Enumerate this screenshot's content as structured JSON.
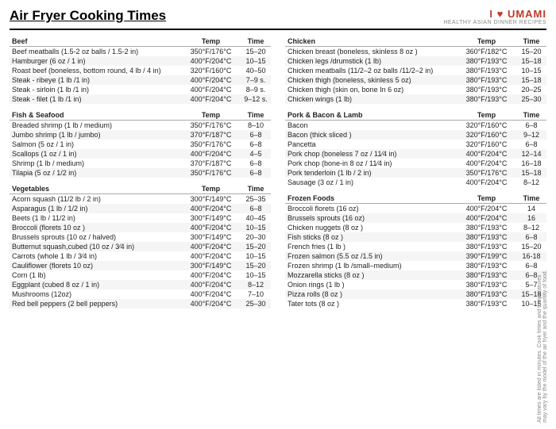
{
  "header": {
    "title": "Air Fryer Cooking Times",
    "brand_name": "I HEART UMAMI",
    "brand_heart": "♥",
    "brand_tagline": "HEALTHY ASIAN DINNER RECIPES",
    "footer_note": "All times are listed in minutes. Cook times and temperatures may vary by the model of the air fryer and the quantity of food."
  },
  "sections": [
    {
      "id": "beef",
      "title": "Beef",
      "col_temp": "Temp",
      "col_time": "Time",
      "rows": [
        [
          "Beef meatballs (1.5-2 oz balls / 1.5-2 in)",
          "350°F/176°C",
          "15–20"
        ],
        [
          "Hamburger (6 oz / 1 in)",
          "400°F/204°C",
          "10–15"
        ],
        [
          "Roast beef (boneless, bottom round, 4 lb / 4 in)",
          "320°F/160°C",
          "40–50"
        ],
        [
          "Steak - ribeye (1 lb /1 in)",
          "400°F/204°C",
          "7–9 s."
        ],
        [
          "Steak - sirloin (1 lb /1 in)",
          "400°F/204°C",
          "8–9 s."
        ],
        [
          "Steak - filet (1 lb /1 in)",
          "400°F/204°C",
          "9–12 s."
        ]
      ]
    },
    {
      "id": "chicken",
      "title": "Chicken",
      "col_temp": "Temp",
      "col_time": "Time",
      "rows": [
        [
          "Chicken breast (boneless, skinless 8 oz )",
          "360°F/182°C",
          "15–20"
        ],
        [
          "Chicken legs /drumstick (1 lb)",
          "380°F/193°C",
          "15–18"
        ],
        [
          "Chicken meatballs (11/2–2 oz balls /11/2–2 in)",
          "380°F/193°C",
          "10–15"
        ],
        [
          "Chicken thigh (boneless, skinless 5 oz)",
          "380°F/193°C",
          "15–18"
        ],
        [
          "Chicken thigh (skin on, bone In 6 oz)",
          "380°F/193°C",
          "20–25"
        ],
        [
          "Chicken wings (1 lb)",
          "380°F/193°C",
          "25–30"
        ]
      ]
    },
    {
      "id": "fish",
      "title": "Fish & Seafood",
      "col_temp": "Temp",
      "col_time": "Time",
      "rows": [
        [
          "Breaded shrimp (1 lb / medium)",
          "350°F/176°C",
          "8–10"
        ],
        [
          "Jumbo shrimp (1 lb / jumbo)",
          "370°F/187°C",
          "6–8"
        ],
        [
          "Salmon (5 oz / 1 in)",
          "350°F/176°C",
          "6–8"
        ],
        [
          "Scallops (1 oz / 1 in)",
          "400°F/204°C",
          "4–5"
        ],
        [
          "Shrimp (1 lb / medium)",
          "370°F/187°C",
          "6–8"
        ],
        [
          "Tilapia (5 oz / 1/2 in)",
          "350°F/176°C",
          "6–8"
        ]
      ]
    },
    {
      "id": "pork",
      "title": "Pork & Bacon & Lamb",
      "col_temp": "Temp",
      "col_time": "Time",
      "rows": [
        [
          "Bacon",
          "320°F/160°C",
          "6–8"
        ],
        [
          "Bacon (thick sliced )",
          "320°F/160°C",
          "9–12"
        ],
        [
          "Pancetta",
          "320°F/160°C",
          "6–8"
        ],
        [
          "Pork chop (boneless 7 oz / 11⁄4 in)",
          "400°F/204°C",
          "12–14"
        ],
        [
          "Pork chop (bone-in 8 oz / 11⁄4 in)",
          "400°F/204°C",
          "16–18"
        ],
        [
          "Pork tenderloin (1 lb / 2 in)",
          "350°F/176°C",
          "15–18"
        ],
        [
          "Sausage (3 oz / 1 in)",
          "400°F/204°C",
          "8–12"
        ]
      ]
    },
    {
      "id": "vegetables",
      "title": "Vegetables",
      "col_temp": "Temp",
      "col_time": "Time",
      "rows": [
        [
          "Acorn squash (11/2 lb / 2 in)",
          "300°F/149°C",
          "25–35"
        ],
        [
          "Asparagus (1 lb / 1/2 in)",
          "400°F/204°C",
          "6–8"
        ],
        [
          "Beets (1 lb / 11/2 in)",
          "300°F/149°C",
          "40–45"
        ],
        [
          "Broccoli (florets 10 oz )",
          "400°F/204°C",
          "10–15"
        ],
        [
          "Brussels sprouts (10 oz / halved)",
          "300°F/149°C",
          "20–30"
        ],
        [
          "Butternut squash,cubed (10 oz / 3⁄4 in)",
          "400°F/204°C",
          "15–20"
        ],
        [
          "Carrots (whole 1 lb / 3⁄4 in)",
          "400°F/204°C",
          "10–15"
        ],
        [
          "Cauliflower (florets 10 oz)",
          "300°F/149°C",
          "15–20"
        ],
        [
          "Corn (1 lb)",
          "400°F/204°C",
          "10–15"
        ],
        [
          "Eggplant (cubed 8 oz / 1 in)",
          "400°F/204°C",
          "8–12"
        ],
        [
          "Mushrooms (12oz)",
          "400°F/204°C",
          "7–10"
        ],
        [
          "Red bell peppers (2 bell peppers)",
          "400°F/204°C",
          "25–30"
        ]
      ]
    },
    {
      "id": "frozen",
      "title": "Frozen Foods",
      "col_temp": "Temp",
      "col_time": "Time",
      "rows": [
        [
          "Broccoli florets (16 oz)",
          "400°F/204°C",
          "14"
        ],
        [
          "Brussels sprouts (16 oz)",
          "400°F/204°C",
          "16"
        ],
        [
          "Chicken nuggets (8 oz )",
          "380°F/193°C",
          "8–12"
        ],
        [
          "Fish sticks (8 oz )",
          "380°F/193°C",
          "6–8"
        ],
        [
          "French fries (1 lb )",
          "380°F/193°C",
          "15–20"
        ],
        [
          "Frozen salmon (5.5 oz /1.5 in)",
          "390°F/199°C",
          "16-18"
        ],
        [
          "Frozen shrimp (1 lb /small–medium)",
          "380°F/193°C",
          "6–8"
        ],
        [
          "Mozzarella sticks (8 oz )",
          "380°F/193°C",
          "6–8"
        ],
        [
          "Onion rings (1 lb )",
          "380°F/193°C",
          "5–7"
        ],
        [
          "Pizza rolls (8 oz )",
          "380°F/193°C",
          "15–18"
        ],
        [
          "Tater tots (8 oz )",
          "380°F/193°C",
          "10–15"
        ]
      ]
    }
  ]
}
